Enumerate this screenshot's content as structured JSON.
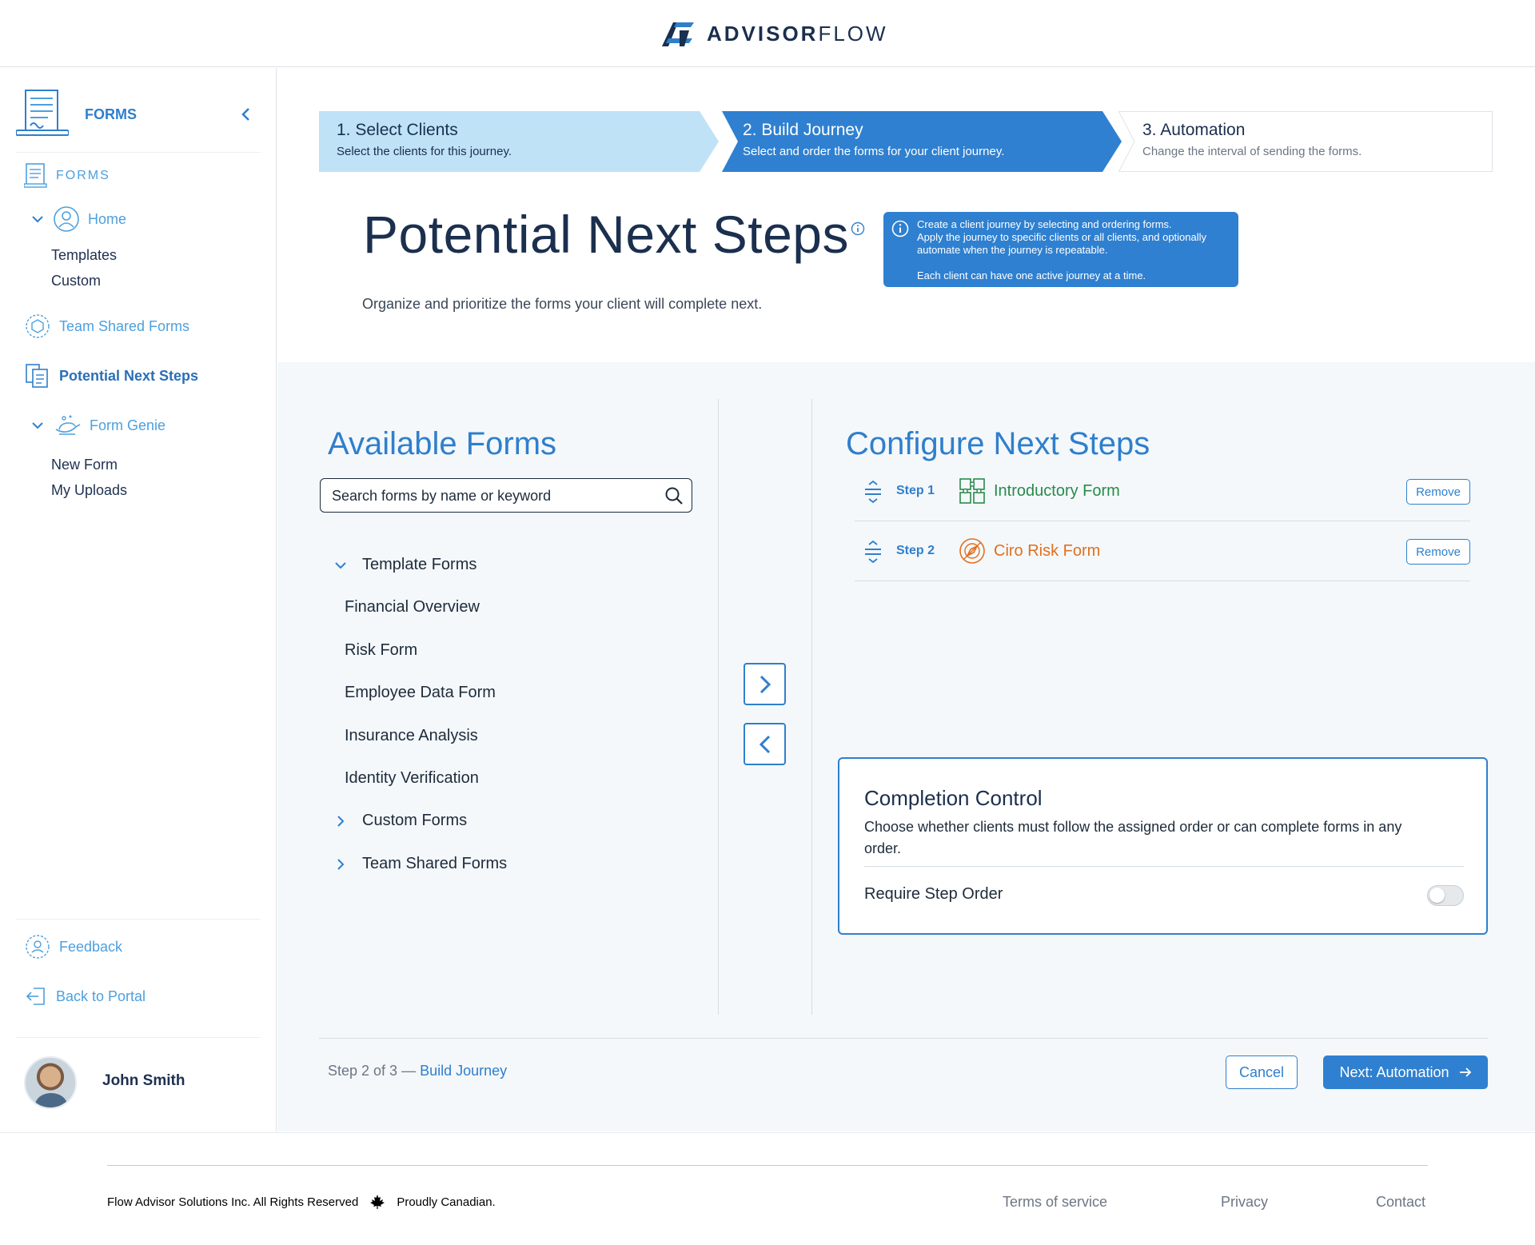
{
  "app": {
    "logo_bold": "ADVISOR",
    "logo_light": "FLOW"
  },
  "colors": {
    "accent": "#2f80d0",
    "accent_light": "#bfe2f7",
    "green": "#2a8a4a",
    "orange": "#e07020",
    "dark_text": "#1b2f4e"
  },
  "sidebar": {
    "header_title": "FORMS",
    "section_label": "FORMS",
    "home": {
      "label": "Home",
      "children": [
        "Templates",
        "Custom"
      ]
    },
    "team_shared": "Team Shared Forms",
    "potential_next_steps": "Potential Next Steps",
    "form_genie": {
      "label": "Form Genie",
      "children": [
        "New Form",
        "My Uploads"
      ]
    },
    "feedback": "Feedback",
    "back_to_portal": "Back to Portal",
    "user_name": "John Smith"
  },
  "stepper": [
    {
      "label": "1. Select Clients",
      "desc": "Select the clients for this journey."
    },
    {
      "label": "2. Build Journey",
      "desc": "Select and order the forms for your client journey."
    },
    {
      "label": "3. Automation",
      "desc": "Change the interval of sending the forms."
    }
  ],
  "page": {
    "title": "Potential Next Steps",
    "subtitle": "Organize and prioritize the forms your client will complete next.",
    "tooltip": {
      "line1": "Create a client journey by selecting and ordering forms.",
      "line2": "Apply the journey to specific clients or all clients, and optionally",
      "line3": "automate when the journey is repeatable.",
      "line4": "Each client can have one active journey at a time."
    }
  },
  "available": {
    "title": "Available Forms",
    "search_placeholder": "Search forms by name or keyword",
    "groups": [
      {
        "name": "Template Forms",
        "expanded": true,
        "items": [
          "Financial Overview",
          "Risk Form",
          "Employee Data Form",
          "Insurance Analysis",
          "Identity Verification"
        ]
      },
      {
        "name": "Custom Forms",
        "expanded": false
      },
      {
        "name": "Team Shared Forms",
        "expanded": false
      }
    ]
  },
  "configure": {
    "title": "Configure Next Steps",
    "steps": [
      {
        "num": "Step 1",
        "name": "Introductory Form",
        "icon": "puzzle-icon",
        "remove": "Remove"
      },
      {
        "num": "Step 2",
        "name": "Ciro Risk Form",
        "icon": "compass-icon",
        "remove": "Remove"
      }
    ]
  },
  "completion": {
    "title": "Completion Control",
    "desc": "Choose whether clients must follow the assigned order or can complete forms in any order.",
    "toggle_label": "Require Step Order",
    "toggle_on": false
  },
  "bottom": {
    "progress_prefix": "Step 2 of 3 — ",
    "progress_current": "Build Journey",
    "cancel": "Cancel",
    "next": "Next: Automation"
  },
  "footer": {
    "copyright": "Flow Advisor Solutions Inc. All Rights Reserved",
    "canadian": "Proudly Canadian.",
    "links": [
      "Terms of service",
      "Privacy",
      "Contact"
    ]
  }
}
